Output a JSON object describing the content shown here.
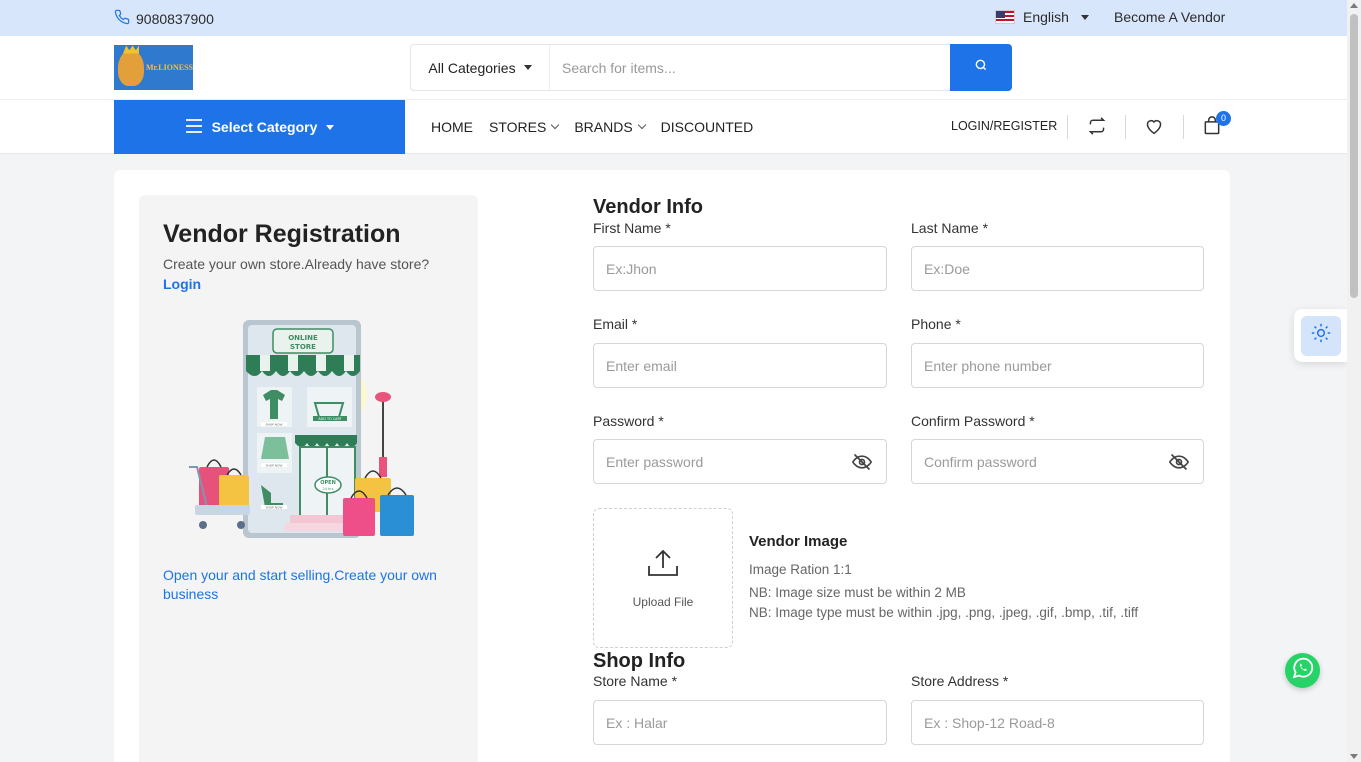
{
  "topbar": {
    "phone": "9080837900",
    "language": "English",
    "become_vendor": "Become A Vendor"
  },
  "header": {
    "logo_text": "Mr.LIONESS",
    "category_select": "All Categories",
    "search_placeholder": "Search for items..."
  },
  "nav": {
    "select_category": "Select Category",
    "links": [
      "HOME",
      "STORES",
      "BRANDS",
      "DISCOUNTED"
    ],
    "login_register": "LOGIN/REGISTER",
    "cart_count": "0"
  },
  "left_panel": {
    "title": "Vendor Registration",
    "subtitle": "Create your own store.Already have store?",
    "login_link": "Login",
    "footer_text": "Open your and start selling.Create your own business",
    "illustration_labels": {
      "store_sign_line1": "ONLINE",
      "store_sign_line2": "STORE",
      "add_to_cart": "ADD TO CART",
      "shop_now": "SHOP NOW",
      "open_line1": "OPEN",
      "open_line2": "24 hrs"
    }
  },
  "vendor_info": {
    "title": "Vendor Info",
    "first_name": {
      "label": "First Name *",
      "placeholder": "Ex:Jhon"
    },
    "last_name": {
      "label": "Last Name *",
      "placeholder": "Ex:Doe"
    },
    "email": {
      "label": "Email *",
      "placeholder": "Enter email"
    },
    "phone": {
      "label": "Phone *",
      "placeholder": "Enter phone number"
    },
    "password": {
      "label": "Password *",
      "placeholder": "Enter password"
    },
    "confirm_password": {
      "label": "Confirm Password *",
      "placeholder": "Confirm password"
    }
  },
  "vendor_image": {
    "upload_label": "Upload File",
    "title": "Vendor Image",
    "ratio": "Image Ration 1:1",
    "size_note": "NB: Image size must be within 2 MB",
    "type_note": "NB: Image type must be within .jpg, .png, .jpeg, .gif, .bmp, .tif, .tiff"
  },
  "shop_info": {
    "title": "Shop Info",
    "store_name": {
      "label": "Store Name *",
      "placeholder": "Ex : Halar"
    },
    "store_address": {
      "label": "Store Address *",
      "placeholder": "Ex : Shop-12 Road-8"
    }
  },
  "colors": {
    "primary": "#1e73e8",
    "topbar_bg": "#d8e6fb",
    "page_bg": "#f3f4f6",
    "whatsapp": "#25d366"
  },
  "icons": [
    "phone-icon",
    "us-flag-icon",
    "search-icon",
    "menu-icon",
    "compare-icon",
    "heart-icon",
    "shopping-bag-icon",
    "eye-off-icon",
    "upload-icon",
    "sun-icon",
    "whatsapp-icon"
  ]
}
